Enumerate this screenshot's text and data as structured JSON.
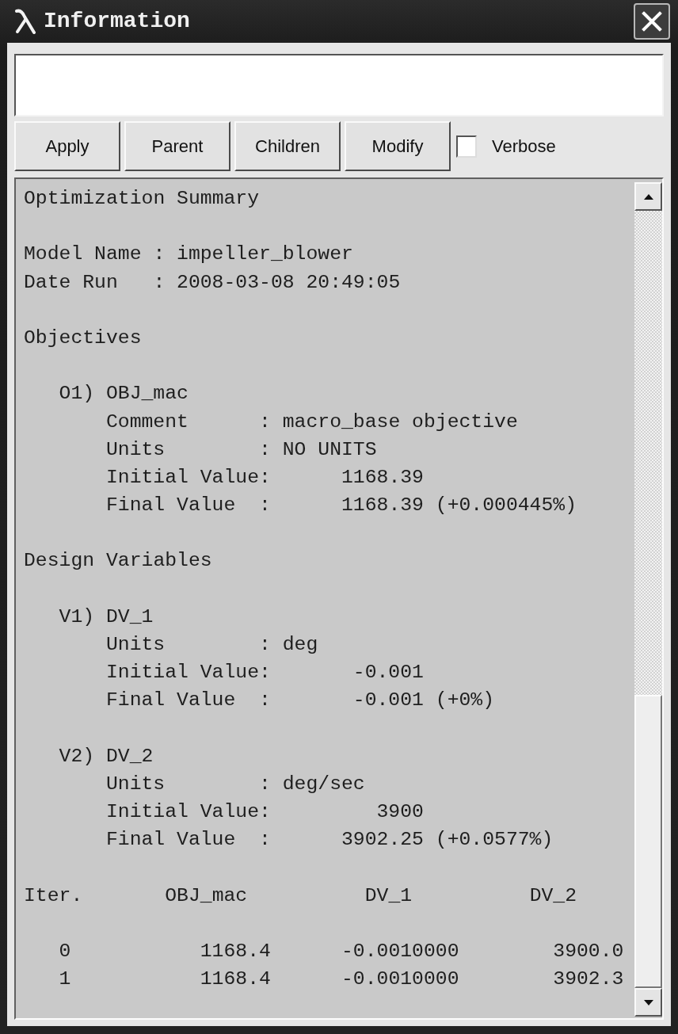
{
  "window": {
    "title": "Information"
  },
  "buttons": [
    {
      "label": "Apply"
    },
    {
      "label": "Parent"
    },
    {
      "label": "Children"
    },
    {
      "label": "Modify"
    }
  ],
  "verbose": {
    "label": "Verbose",
    "checked": false
  },
  "output": {
    "title": "Optimization Summary",
    "info": [
      {
        "label": "Model Name",
        "separator": ":",
        "value": "impeller_blower"
      },
      {
        "label": "Date Run",
        "separator": ":",
        "value": "2008-03-08 20:49:05"
      }
    ],
    "sections": [
      {
        "heading": "Objectives",
        "items": [
          {
            "tag": "O1)",
            "name": "OBJ_mac",
            "fields": [
              {
                "kind": "text",
                "label": "Comment",
                "separator": ":",
                "value": "macro_base objective"
              },
              {
                "kind": "text",
                "label": "Units",
                "separator": ":",
                "value": "NO UNITS"
              },
              {
                "kind": "number",
                "label": "Initial Value",
                "separator": ":",
                "value": "1168.39"
              },
              {
                "kind": "number",
                "label": "Final Value",
                "separator": ":",
                "value": "1168.39",
                "change": "(+0.000445%)"
              }
            ]
          }
        ]
      },
      {
        "heading": "Design Variables",
        "items": [
          {
            "tag": "V1)",
            "name": "DV_1",
            "fields": [
              {
                "kind": "text",
                "label": "Units",
                "separator": ":",
                "value": "deg"
              },
              {
                "kind": "number",
                "label": "Initial Value",
                "separator": ":",
                "value": "-0.001"
              },
              {
                "kind": "number",
                "label": "Final Value",
                "separator": ":",
                "value": "-0.001",
                "change": "(+0%)"
              }
            ]
          },
          {
            "tag": "V2)",
            "name": "DV_2",
            "fields": [
              {
                "kind": "text",
                "label": "Units",
                "separator": ":",
                "value": "deg/sec"
              },
              {
                "kind": "number",
                "label": "Initial Value",
                "separator": ":",
                "value": "3900"
              },
              {
                "kind": "number",
                "label": "Final Value",
                "separator": ":",
                "value": "3902.25",
                "change": "(+0.0577%)"
              }
            ]
          }
        ]
      }
    ],
    "iterations": {
      "columns": [
        "Iter.",
        "OBJ_mac",
        "DV_1",
        "DV_2"
      ],
      "rows": [
        [
          "0",
          "1168.4",
          "-0.0010000",
          "3900.0"
        ],
        [
          "1",
          "1168.4",
          "-0.0010000",
          "3902.3"
        ]
      ]
    }
  }
}
